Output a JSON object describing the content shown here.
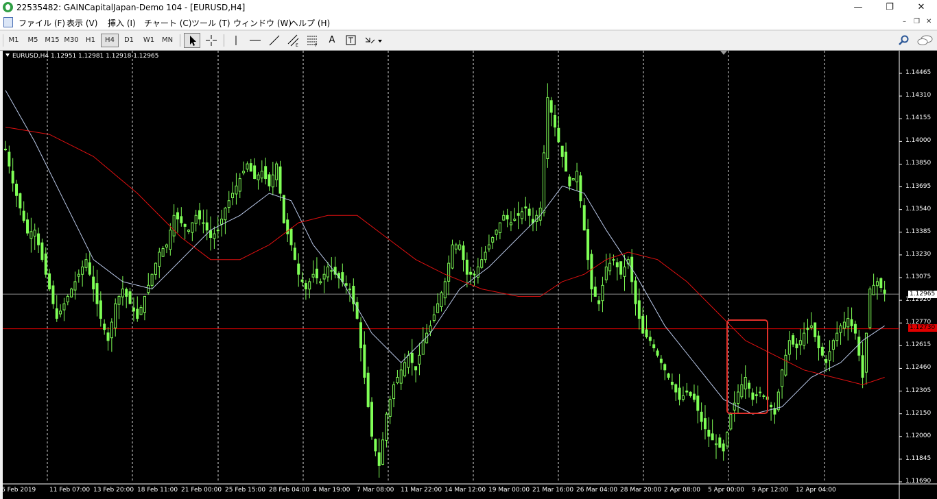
{
  "window": {
    "title": "22535482: GAINCapitalJapan-Demo 104 - [EURUSD,H4]",
    "minimize": "—",
    "restore": "❐",
    "close": "✕"
  },
  "menu": [
    "ファイル (F)",
    "表示 (V)",
    "挿入 (I)",
    "チャート (C)",
    "ツール (T)",
    "ウィンドウ (W)",
    "ヘルプ (H)"
  ],
  "mdi": {
    "minimize": "–",
    "restore": "❐",
    "close": "✕"
  },
  "timeframes": [
    "M1",
    "M5",
    "M15",
    "M30",
    "H1",
    "H4",
    "D1",
    "W1",
    "MN"
  ],
  "active_timeframe": "H4",
  "tools": [
    "cursor-icon",
    "crosshair-icon",
    "vertical-line-icon",
    "horizontal-line-icon",
    "trendline-icon",
    "channel-icon",
    "fibonacci-icon",
    "text-icon",
    "label-icon",
    "arrows-icon"
  ],
  "tool_text": "A",
  "chart": {
    "header": "EURUSD,H4  1.12951 1.12981 1.12918 1.12965",
    "current_price": "1.12965",
    "hline_price": "1.12730",
    "colors": {
      "background": "#000000",
      "candles": "#7fff56",
      "ma_fast": "#b9c8e8",
      "ma_slow": "#e01010",
      "hline": "#e00000",
      "highlight_box": "#e0302a"
    }
  },
  "chart_data": {
    "type": "line",
    "symbol": "EURUSD",
    "timeframe": "H4",
    "ylim": [
      1.1169,
      1.14465
    ],
    "y_ticks": [
      "1.14465",
      "1.14310",
      "1.14155",
      "1.14000",
      "1.13850",
      "1.13695",
      "1.13540",
      "1.13385",
      "1.13230",
      "1.13075",
      "1.12920",
      "1.12770",
      "1.12615",
      "1.12460",
      "1.12305",
      "1.12150",
      "1.12000",
      "1.11845",
      "1.11690"
    ],
    "x_labels": [
      "6 Feb 2019",
      "11 Feb 07:00",
      "13 Feb 20:00",
      "18 Feb 11:00",
      "21 Feb 00:00",
      "25 Feb 15:00",
      "28 Feb 04:00",
      "4 Mar 19:00",
      "7 Mar 08:00",
      "11 Mar 22:00",
      "14 Mar 12:00",
      "19 Mar 00:00",
      "21 Mar 16:00",
      "26 Mar 04:00",
      "28 Mar 20:00",
      "2 Apr 08:00",
      "5 Apr 00:00",
      "9 Apr 12:00",
      "12 Apr 04:00"
    ],
    "price_path": [
      [
        0,
        1.1395
      ],
      [
        2,
        1.1372
      ],
      [
        4,
        1.1355
      ],
      [
        6,
        1.1338
      ],
      [
        8,
        1.134
      ],
      [
        10,
        1.132
      ],
      [
        12,
        1.13
      ],
      [
        14,
        1.128
      ],
      [
        16,
        1.129
      ],
      [
        18,
        1.13
      ],
      [
        20,
        1.131
      ],
      [
        22,
        1.132
      ],
      [
        24,
        1.13
      ],
      [
        26,
        1.128
      ],
      [
        28,
        1.1265
      ],
      [
        30,
        1.129
      ],
      [
        32,
        1.13
      ],
      [
        34,
        1.129
      ],
      [
        36,
        1.128
      ],
      [
        38,
        1.1295
      ],
      [
        40,
        1.131
      ],
      [
        42,
        1.1325
      ],
      [
        44,
        1.133
      ],
      [
        46,
        1.135
      ],
      [
        48,
        1.1345
      ],
      [
        50,
        1.134
      ],
      [
        52,
        1.135
      ],
      [
        54,
        1.1345
      ],
      [
        56,
        1.1335
      ],
      [
        58,
        1.134
      ],
      [
        60,
        1.1355
      ],
      [
        62,
        1.1365
      ],
      [
        64,
        1.1375
      ],
      [
        66,
        1.1385
      ],
      [
        68,
        1.1375
      ],
      [
        70,
        1.138
      ],
      [
        72,
        1.137
      ],
      [
        74,
        1.1385
      ],
      [
        76,
        1.1345
      ],
      [
        78,
        1.133
      ],
      [
        80,
        1.131
      ],
      [
        82,
        1.13
      ],
      [
        84,
        1.131
      ],
      [
        86,
        1.1305
      ],
      [
        88,
        1.1315
      ],
      [
        90,
        1.131
      ],
      [
        92,
        1.1305
      ],
      [
        94,
        1.13
      ],
      [
        96,
        1.128
      ],
      [
        98,
        1.124
      ],
      [
        100,
        1.12
      ],
      [
        102,
        1.118
      ],
      [
        104,
        1.1215
      ],
      [
        106,
        1.1235
      ],
      [
        108,
        1.1245
      ],
      [
        110,
        1.1255
      ],
      [
        112,
        1.1245
      ],
      [
        114,
        1.1265
      ],
      [
        116,
        1.1275
      ],
      [
        118,
        1.129
      ],
      [
        120,
        1.1305
      ],
      [
        122,
        1.133
      ],
      [
        124,
        1.133
      ],
      [
        126,
        1.131
      ],
      [
        128,
        1.131
      ],
      [
        130,
        1.132
      ],
      [
        132,
        1.133
      ],
      [
        134,
        1.134
      ],
      [
        136,
        1.135
      ],
      [
        138,
        1.1345
      ],
      [
        140,
        1.135
      ],
      [
        142,
        1.1355
      ],
      [
        144,
        1.1345
      ],
      [
        146,
        1.1355
      ],
      [
        148,
        1.143
      ],
      [
        150,
        1.141
      ],
      [
        152,
        1.139
      ],
      [
        154,
        1.137
      ],
      [
        156,
        1.138
      ],
      [
        158,
        1.134
      ],
      [
        160,
        1.13
      ],
      [
        162,
        1.129
      ],
      [
        164,
        1.1315
      ],
      [
        166,
        1.132
      ],
      [
        168,
        1.131
      ],
      [
        170,
        1.132
      ],
      [
        172,
        1.129
      ],
      [
        174,
        1.127
      ],
      [
        176,
        1.1265
      ],
      [
        178,
        1.1255
      ],
      [
        180,
        1.1245
      ],
      [
        182,
        1.1235
      ],
      [
        184,
        1.1225
      ],
      [
        186,
        1.123
      ],
      [
        188,
        1.1225
      ],
      [
        190,
        1.121
      ],
      [
        192,
        1.12
      ],
      [
        194,
        1.1195
      ],
      [
        196,
        1.119
      ],
      [
        198,
        1.1215
      ],
      [
        200,
        1.123
      ],
      [
        202,
        1.124
      ],
      [
        204,
        1.1225
      ],
      [
        206,
        1.123
      ],
      [
        208,
        1.1225
      ],
      [
        210,
        1.1215
      ],
      [
        212,
        1.1245
      ],
      [
        214,
        1.1265
      ],
      [
        216,
        1.126
      ],
      [
        218,
        1.127
      ],
      [
        220,
        1.1275
      ],
      [
        222,
        1.126
      ],
      [
        224,
        1.125
      ],
      [
        226,
        1.1265
      ],
      [
        228,
        1.1275
      ],
      [
        230,
        1.128
      ],
      [
        232,
        1.127
      ],
      [
        234,
        1.124
      ],
      [
        236,
        1.13
      ],
      [
        238,
        1.1305
      ],
      [
        240,
        1.1297
      ]
    ],
    "series": [
      {
        "values": [
          [
            0,
            1.1435
          ],
          [
            8,
            1.14
          ],
          [
            16,
            1.136
          ],
          [
            24,
            1.132
          ],
          [
            32,
            1.1305
          ],
          [
            40,
            1.13
          ],
          [
            48,
            1.132
          ],
          [
            56,
            1.134
          ],
          [
            64,
            1.135
          ],
          [
            72,
            1.1365
          ],
          [
            78,
            1.136
          ],
          [
            84,
            1.133
          ],
          [
            92,
            1.1305
          ],
          [
            100,
            1.127
          ],
          [
            108,
            1.125
          ],
          [
            116,
            1.127
          ],
          [
            124,
            1.13
          ],
          [
            132,
            1.1315
          ],
          [
            140,
            1.1335
          ],
          [
            146,
            1.135
          ],
          [
            152,
            1.137
          ],
          [
            158,
            1.1365
          ],
          [
            164,
            1.134
          ],
          [
            172,
            1.131
          ],
          [
            180,
            1.1275
          ],
          [
            188,
            1.125
          ],
          [
            196,
            1.1225
          ],
          [
            204,
            1.1215
          ],
          [
            212,
            1.122
          ],
          [
            220,
            1.124
          ],
          [
            228,
            1.125
          ],
          [
            234,
            1.1265
          ],
          [
            240,
            1.1275
          ]
        ]
      },
      {
        "values": [
          [
            0,
            1.141
          ],
          [
            12,
            1.1405
          ],
          [
            24,
            1.139
          ],
          [
            36,
            1.1365
          ],
          [
            48,
            1.1335
          ],
          [
            56,
            1.132
          ],
          [
            64,
            1.132
          ],
          [
            72,
            1.133
          ],
          [
            80,
            1.1345
          ],
          [
            88,
            1.135
          ],
          [
            96,
            1.135
          ],
          [
            104,
            1.1335
          ],
          [
            112,
            1.132
          ],
          [
            120,
            1.131
          ],
          [
            130,
            1.13
          ],
          [
            140,
            1.1295
          ],
          [
            146,
            1.1295
          ],
          [
            152,
            1.1305
          ],
          [
            158,
            1.131
          ],
          [
            164,
            1.132
          ],
          [
            170,
            1.1325
          ],
          [
            178,
            1.132
          ],
          [
            186,
            1.1305
          ],
          [
            194,
            1.1285
          ],
          [
            202,
            1.1265
          ],
          [
            210,
            1.1255
          ],
          [
            218,
            1.1245
          ],
          [
            226,
            1.124
          ],
          [
            234,
            1.1235
          ],
          [
            240,
            1.124
          ]
        ]
      }
    ]
  }
}
